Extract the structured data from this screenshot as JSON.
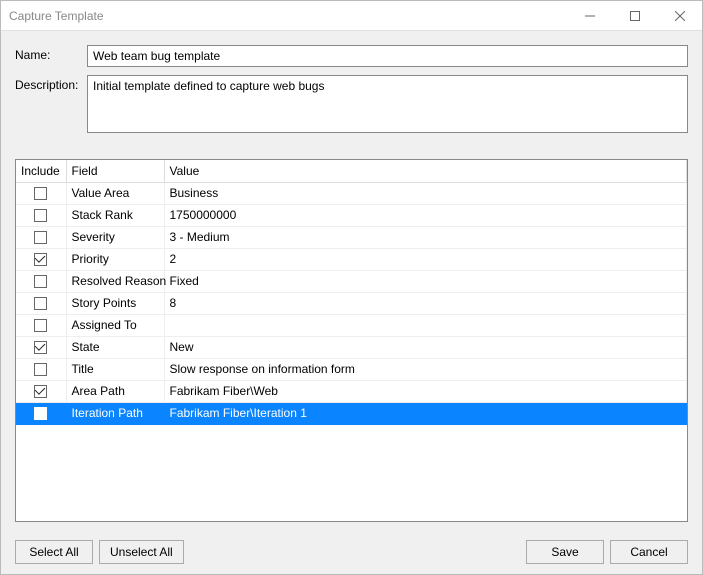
{
  "window": {
    "title": "Capture Template"
  },
  "form": {
    "name_label": "Name:",
    "name_value": "Web team bug template",
    "desc_label": "Description:",
    "desc_value": "Initial template defined to capture web bugs"
  },
  "grid": {
    "headers": {
      "include": "Include",
      "field": "Field",
      "value": "Value"
    },
    "rows": [
      {
        "include": false,
        "field": "Value Area",
        "value": "Business",
        "selected": false
      },
      {
        "include": false,
        "field": "Stack Rank",
        "value": "1750000000",
        "selected": false
      },
      {
        "include": false,
        "field": "Severity",
        "value": "3 - Medium",
        "selected": false
      },
      {
        "include": true,
        "field": "Priority",
        "value": "2",
        "selected": false
      },
      {
        "include": false,
        "field": "Resolved Reason",
        "value": "Fixed",
        "selected": false
      },
      {
        "include": false,
        "field": "Story Points",
        "value": "8",
        "selected": false
      },
      {
        "include": false,
        "field": "Assigned To",
        "value": "",
        "selected": false
      },
      {
        "include": true,
        "field": "State",
        "value": "New",
        "selected": false
      },
      {
        "include": false,
        "field": "Title",
        "value": "Slow response on information form",
        "selected": false
      },
      {
        "include": true,
        "field": "Area Path",
        "value": "Fabrikam Fiber\\Web",
        "selected": false
      },
      {
        "include": false,
        "field": "Iteration Path",
        "value": "Fabrikam Fiber\\Iteration 1",
        "selected": true
      }
    ]
  },
  "buttons": {
    "select_all": "Select All",
    "unselect_all": "Unselect All",
    "save": "Save",
    "cancel": "Cancel"
  }
}
